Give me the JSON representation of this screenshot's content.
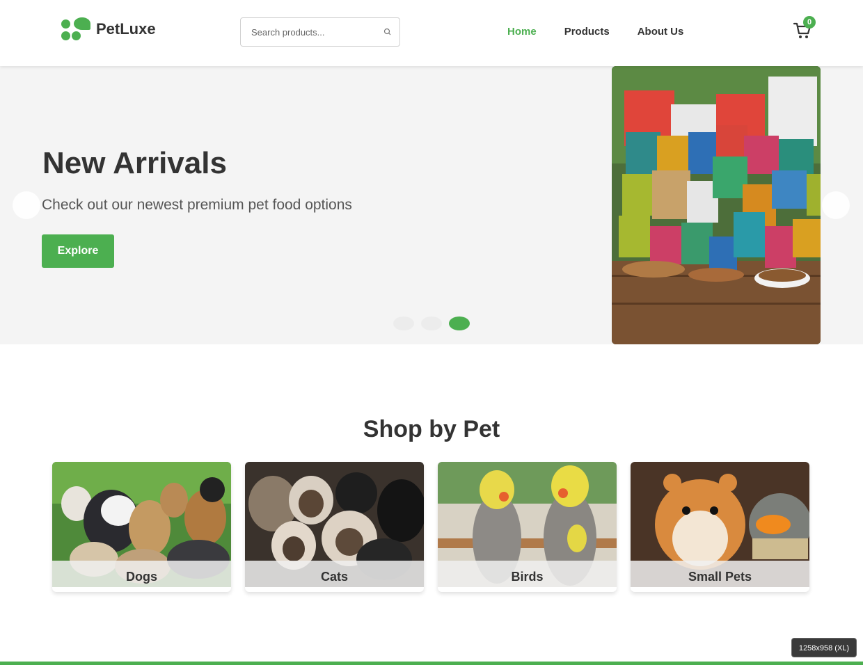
{
  "brand": {
    "name": "PetLuxe",
    "accent": "#4caf50"
  },
  "search": {
    "placeholder": "Search products..."
  },
  "nav": {
    "items": [
      {
        "label": "Home",
        "active": true
      },
      {
        "label": "Products",
        "active": false
      },
      {
        "label": "About Us",
        "active": false
      }
    ]
  },
  "cart": {
    "count": "0",
    "icon": "cart-icon"
  },
  "hero": {
    "title": "New Arrivals",
    "subtitle": "Check out our newest premium pet food options",
    "button": "Explore",
    "slide_count": 3,
    "active_slide": 3
  },
  "categories": {
    "title": "Shop by Pet",
    "items": [
      {
        "label": "Dogs"
      },
      {
        "label": "Cats"
      },
      {
        "label": "Birds"
      },
      {
        "label": "Small Pets"
      }
    ]
  },
  "viewport_badge": "1258x958 (XL)"
}
